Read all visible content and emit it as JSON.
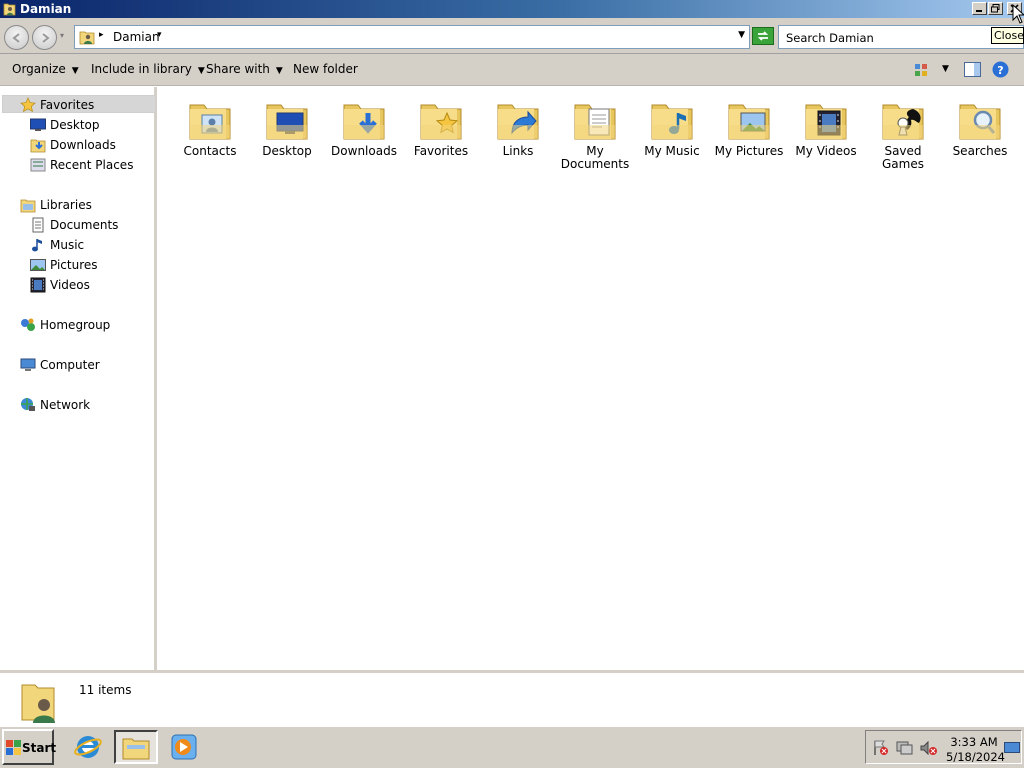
{
  "window": {
    "title": "Damian"
  },
  "caption_buttons": {
    "close_tooltip": "Close"
  },
  "address": {
    "breadcrumb": "Damian",
    "search_placeholder": "Search Damian"
  },
  "toolbar": {
    "organize": "Organize",
    "include_in_library": "Include in library",
    "share_with": "Share with",
    "new_folder": "New folder"
  },
  "sidebar": {
    "favorites": {
      "label": "Favorites",
      "items": [
        "Desktop",
        "Downloads",
        "Recent Places"
      ]
    },
    "libraries": {
      "label": "Libraries",
      "items": [
        "Documents",
        "Music",
        "Pictures",
        "Videos"
      ]
    },
    "homegroup": "Homegroup",
    "computer": "Computer",
    "network": "Network"
  },
  "folders": [
    {
      "label": "Contacts",
      "icon": "contacts-folder-icon"
    },
    {
      "label": "Desktop",
      "icon": "desktop-folder-icon"
    },
    {
      "label": "Downloads",
      "icon": "downloads-folder-icon"
    },
    {
      "label": "Favorites",
      "icon": "favorites-folder-icon"
    },
    {
      "label": "Links",
      "icon": "links-folder-icon"
    },
    {
      "label": "My Documents",
      "icon": "documents-folder-icon"
    },
    {
      "label": "My Music",
      "icon": "music-folder-icon"
    },
    {
      "label": "My Pictures",
      "icon": "pictures-folder-icon"
    },
    {
      "label": "My Videos",
      "icon": "videos-folder-icon"
    },
    {
      "label": "Saved Games",
      "icon": "saved-games-folder-icon"
    },
    {
      "label": "Searches",
      "icon": "searches-folder-icon"
    }
  ],
  "status": {
    "item_count": "11 items"
  },
  "taskbar": {
    "start": "Start",
    "time": "3:33 AM",
    "date": "5/18/2024"
  },
  "colors": {
    "titlebar": "#0a246a",
    "chrome": "#d4d0c8",
    "folder": "#f2d67b",
    "accent": "#2a6fd6"
  }
}
